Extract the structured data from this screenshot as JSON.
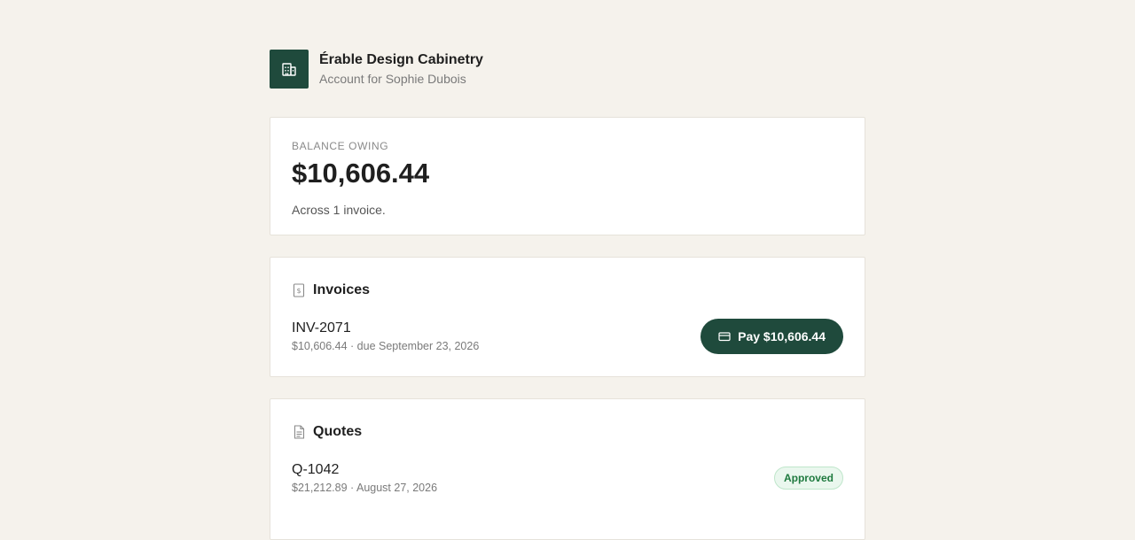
{
  "header": {
    "business_name": "Érable Design Cabinetry",
    "account_line": "Account for Sophie Dubois",
    "logo_icon": "building-icon"
  },
  "balance": {
    "label": "BALANCE OWING",
    "amount": "$10,606.44",
    "subtext": "Across 1 invoice."
  },
  "invoices": {
    "title": "Invoices",
    "icon": "receipt-dollar-icon",
    "items": [
      {
        "id": "INV-2071",
        "meta": "$10,606.44 · due September 23, 2026",
        "pay_label": "Pay $10,606.44",
        "pay_icon": "credit-card-icon"
      }
    ]
  },
  "quotes": {
    "title": "Quotes",
    "icon": "document-icon",
    "items": [
      {
        "id": "Q-1042",
        "meta": "$21,212.89 · August 27, 2026",
        "status": "Approved"
      }
    ]
  },
  "colors": {
    "brand": "#1f4a3c",
    "background": "#f5f2ec",
    "approved_bg": "#eaf7ee",
    "approved_text": "#1f7a3f"
  }
}
